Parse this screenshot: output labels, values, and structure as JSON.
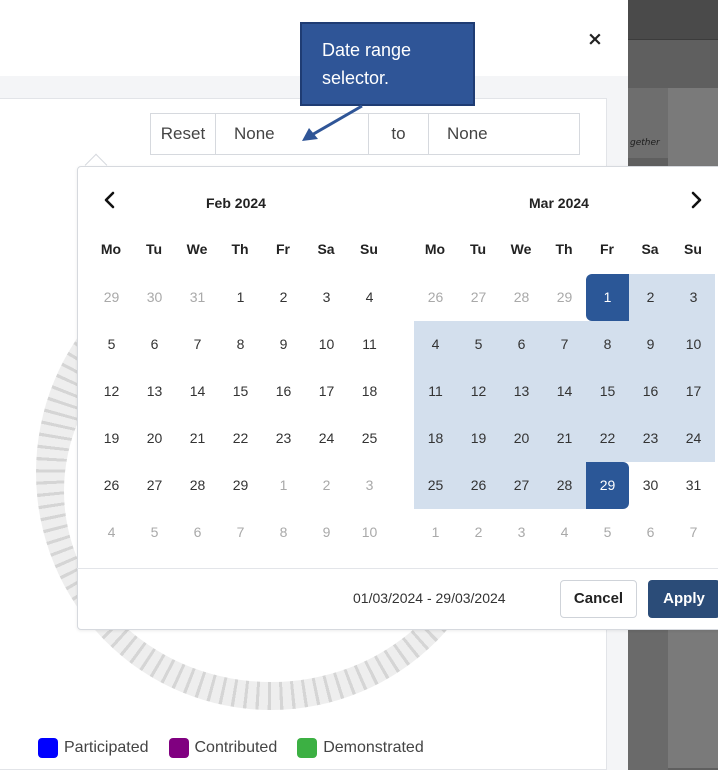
{
  "background_app": {
    "panel_text": "gether"
  },
  "modal": {
    "close_label": "×"
  },
  "date_input": {
    "reset_label": "Reset",
    "start_value": "None",
    "to_label": "to",
    "end_value": "None"
  },
  "callout": {
    "line1": "Date range",
    "line2": "selector."
  },
  "calendar": {
    "prev_label": "‹",
    "next_label": "›",
    "weekdays": [
      "Mo",
      "Tu",
      "We",
      "Th",
      "Fr",
      "Sa",
      "Su"
    ],
    "months": [
      {
        "title": "Feb 2024",
        "weeks": [
          [
            "29",
            "30",
            "31",
            "1",
            "2",
            "3",
            "4"
          ],
          [
            "5",
            "6",
            "7",
            "8",
            "9",
            "10",
            "11"
          ],
          [
            "12",
            "13",
            "14",
            "15",
            "16",
            "17",
            "18"
          ],
          [
            "19",
            "20",
            "21",
            "22",
            "23",
            "24",
            "25"
          ],
          [
            "26",
            "27",
            "28",
            "29",
            "1",
            "2",
            "3"
          ],
          [
            "4",
            "5",
            "6",
            "7",
            "8",
            "9",
            "10"
          ]
        ]
      },
      {
        "title": "Mar 2024",
        "weeks": [
          [
            "26",
            "27",
            "28",
            "29",
            "1",
            "2",
            "3"
          ],
          [
            "4",
            "5",
            "6",
            "7",
            "8",
            "9",
            "10"
          ],
          [
            "11",
            "12",
            "13",
            "14",
            "15",
            "16",
            "17"
          ],
          [
            "18",
            "19",
            "20",
            "21",
            "22",
            "23",
            "24"
          ],
          [
            "25",
            "26",
            "27",
            "28",
            "29",
            "30",
            "31"
          ],
          [
            "1",
            "2",
            "3",
            "4",
            "5",
            "6",
            "7"
          ]
        ]
      }
    ],
    "selected_range_text": "01/03/2024 - 29/03/2024",
    "cancel_label": "Cancel",
    "apply_label": "Apply",
    "colors": {
      "selected": "#2b5797",
      "in_range": "#d3dfed",
      "apply_button": "#2b4c78"
    }
  },
  "legend": [
    {
      "label": "Participated",
      "color": "#0000ff"
    },
    {
      "label": "Contributed",
      "color": "#800080"
    },
    {
      "label": "Demonstrated",
      "color": "#3cb043"
    }
  ]
}
